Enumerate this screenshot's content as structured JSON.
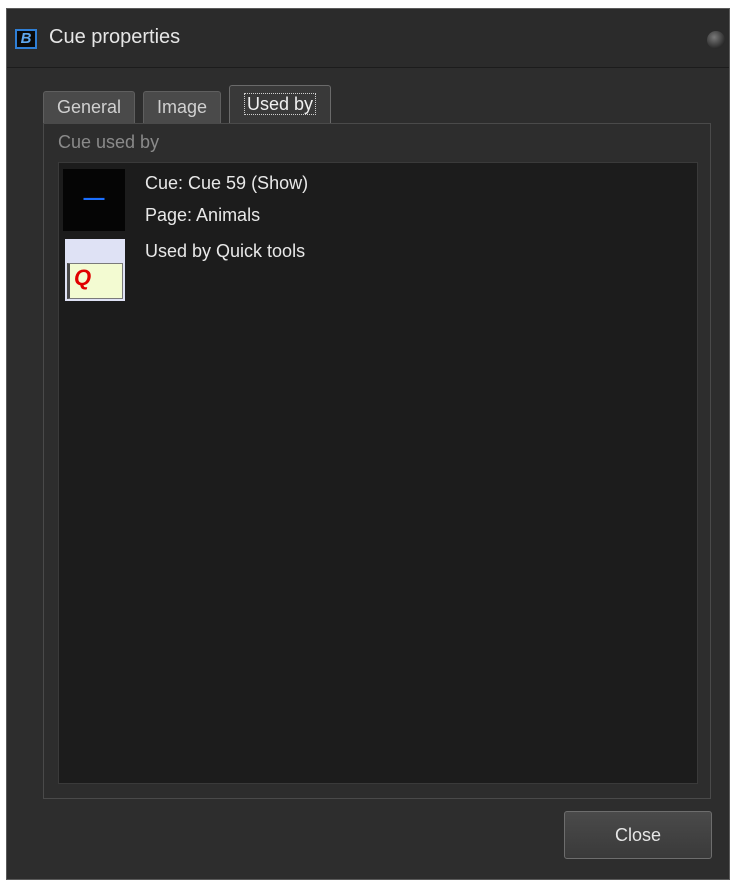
{
  "window": {
    "title": "Cue properties"
  },
  "tabs": [
    {
      "label": "General"
    },
    {
      "label": "Image"
    },
    {
      "label": "Used by"
    }
  ],
  "active_tab": "Used by",
  "panel": {
    "group_label": "Cue used by",
    "items": [
      {
        "lines": [
          "Cue: Cue 59 (Show)",
          "Page: Animals"
        ],
        "thumb_icon": "cue-thumbnail"
      },
      {
        "lines": [
          "Used by Quick tools"
        ],
        "thumb_icon": "quick-tools-icon",
        "thumb_letter": "Q"
      }
    ]
  },
  "buttons": {
    "close_label": "Close"
  },
  "colors": {
    "window_bg": "#2d2d2d",
    "list_bg": "#1c1c1c",
    "accent": "#2f7fd6",
    "quick_q": "#e00000"
  }
}
